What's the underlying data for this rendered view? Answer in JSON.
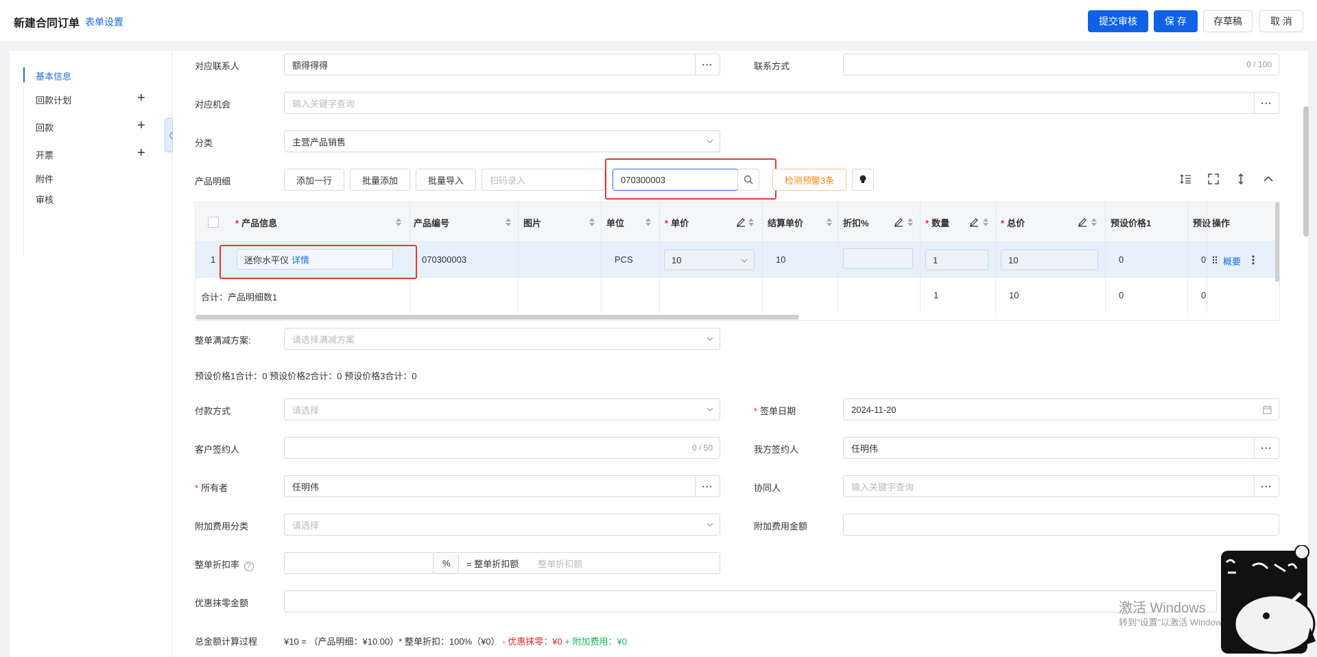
{
  "header": {
    "title": "新建合同订单",
    "form_settings": "表单设置",
    "submit_review": "提交审核",
    "save": "保 存",
    "save_draft": "存草稿",
    "cancel": "取 消"
  },
  "sidebar": {
    "items": [
      {
        "label": "基本信息",
        "active": true
      },
      {
        "label": "回款计划",
        "plus": true
      },
      {
        "label": "回款",
        "plus": true
      },
      {
        "label": "开票",
        "plus": true
      },
      {
        "label": "附件"
      },
      {
        "label": "审核"
      }
    ],
    "plus": "+",
    "collapse": "〈"
  },
  "form": {
    "contact_label": "对应联系人",
    "contact_value": "额得得得",
    "contact_method_label": "联系方式",
    "contact_method_counter": "0 / 100",
    "opportunity_label": "对应机会",
    "opportunity_placeholder": "输入关键字查询",
    "category_label": "分类",
    "category_value": "主营产品销售",
    "product_detail_label": "产品明细",
    "add_row": "添加一行",
    "batch_add": "批量添加",
    "batch_import": "批量导入",
    "scan_placeholder": "扫码录入",
    "search_value": "070300003",
    "warning_btn": "检测预警3条",
    "discount_plan_label": "整单满减方案:",
    "discount_plan_placeholder": "请选择满减方案",
    "preset_totals": "预设价格1合计：0  预设价格2合计：0  预设价格3合计：0",
    "payment_label": "付款方式",
    "payment_placeholder": "请选择",
    "sign_date_label": "签单日期",
    "sign_date_value": "2024-11-20",
    "customer_signer_label": "客户签约人",
    "customer_signer_counter": "0 / 50",
    "our_signer_label": "我方签约人",
    "our_signer_value": "任明伟",
    "owner_label": "所有者",
    "owner_value": "任明伟",
    "collaborator_label": "协同人",
    "collaborator_placeholder": "输入关键字查询",
    "extra_fee_cat_label": "附加费用分类",
    "extra_fee_cat_placeholder": "请选择",
    "extra_fee_amount_label": "附加费用金额",
    "discount_rate_label": "整单折扣率",
    "help_icon": "?",
    "percent": "%",
    "discount_amount_label": "= 整单折扣额",
    "discount_amount_placeholder": "整单折扣额",
    "rounding_label": "优惠抹零金额",
    "total_calc_label": "总金额计算过程",
    "calc_main": "¥10 = （产品明细：¥10.00）* 整单折扣：100%（¥0）",
    "calc_red": " - 优惠抹零：¥0",
    "calc_green": " + 附加费用：¥0"
  },
  "table": {
    "columns": [
      "*产品信息",
      "产品编号",
      "图片",
      "单位",
      "*单价",
      "结算单价",
      "折扣%",
      "*数量",
      "*总价",
      "预设价格1",
      "预设",
      "操作"
    ],
    "row": {
      "index": "1",
      "product_name": "迷你水平仪",
      "detail_link": "详情",
      "product_code": "070300003",
      "unit": "PCS",
      "unit_price": "10",
      "settle_price": "10",
      "quantity": "1",
      "total": "10",
      "preset1": "0",
      "preset2": "0",
      "summary_link": "概要"
    },
    "sum_row": {
      "label": "合计：产品明细数1",
      "quantity": "1",
      "total": "10",
      "preset1": "0",
      "preset2": "0"
    }
  },
  "watermark": {
    "line1": "激活 Windows",
    "line2": "转到\"设置\"以激活 Windows。"
  },
  "colors": {
    "primary": "#0f62e6",
    "link": "#1f6ee0",
    "required": "#f5222d",
    "warning": "#fa8c16",
    "highlight_box": "#e53935",
    "row_selected": "#e6f1fc"
  }
}
